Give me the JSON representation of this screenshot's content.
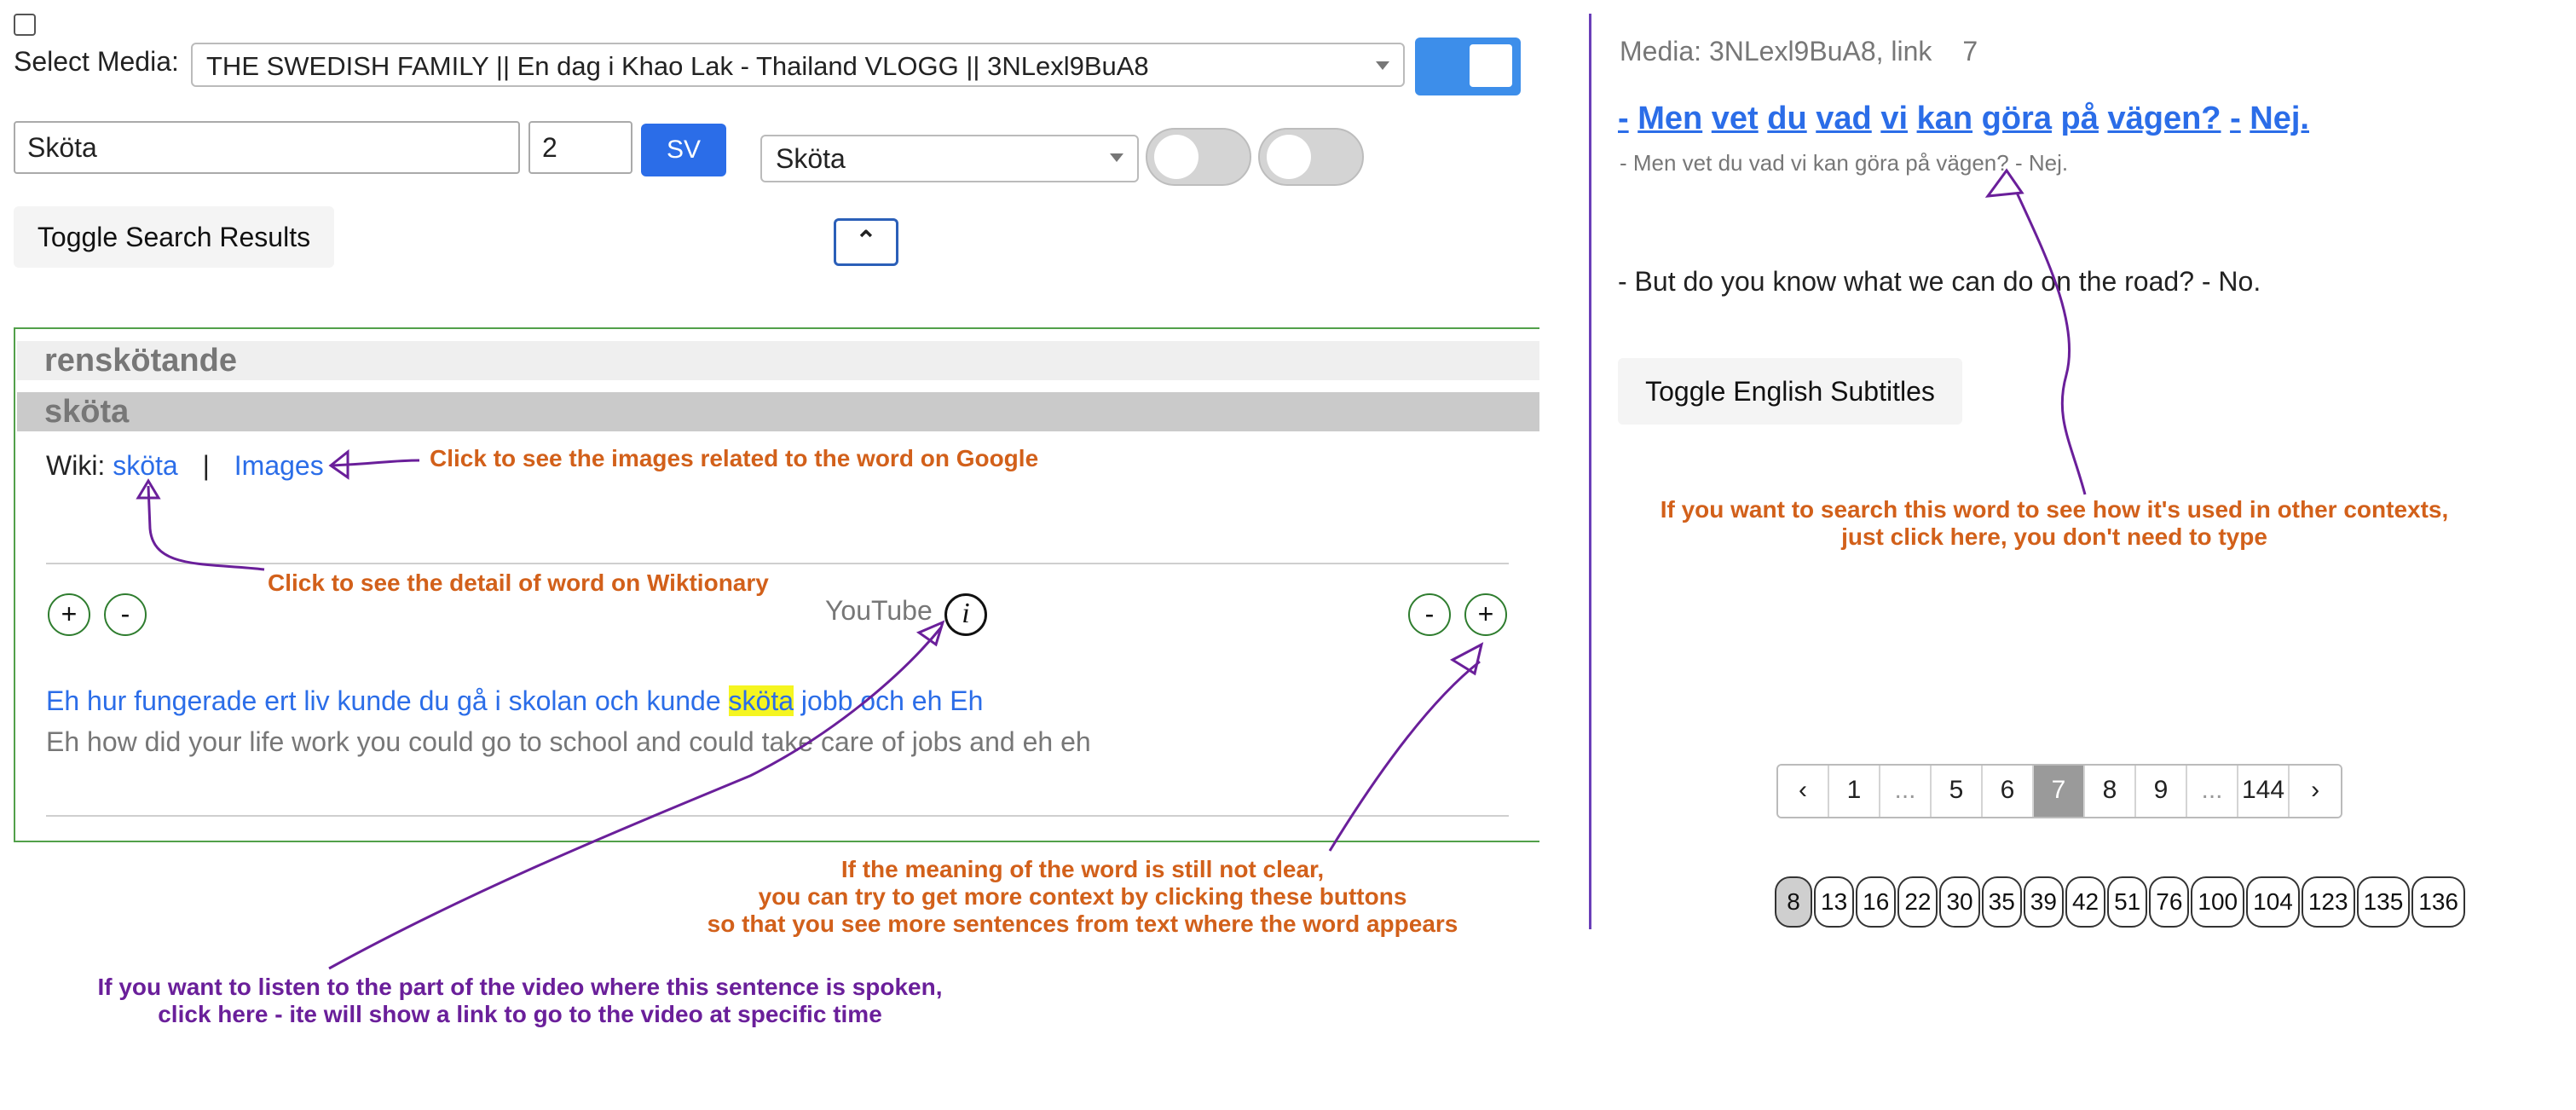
{
  "select_media": {
    "label": "Select Media:",
    "value": "THE SWEDISH FAMILY || En dag i Khao Lak - Thailand VLOGG || 3NLexl9BuA8"
  },
  "search": {
    "query": "Sköta",
    "count": "2",
    "lang_button": "SV",
    "word_dropdown": "Sköta"
  },
  "buttons": {
    "toggle_results": "Toggle Search Results",
    "collapse_glyph": "⌃",
    "toggle_english": "Toggle English Subtitles"
  },
  "results": {
    "word1": "renskötande",
    "word2": "sköta",
    "wiki_label": "Wiki:",
    "wiki_link": "sköta",
    "separator": "|",
    "images_link": "Images",
    "plus": "+",
    "minus": "-",
    "youtube_label": "YouTube",
    "info_glyph": "i",
    "sentence_sv_before": "Eh hur fungerade ert liv kunde du gå i skolan och kunde ",
    "sentence_sv_highlight": "sköta",
    "sentence_sv_after": " jobb och eh Eh",
    "sentence_en": "Eh how did your life work you could go to school and could take care of jobs and eh eh"
  },
  "right_panel": {
    "media_label": "Media: 3NLexl9BuA8, link",
    "media_number": "7",
    "sv_tokens": [
      "-",
      "Men",
      "vet",
      "du",
      "vad",
      "vi",
      "kan",
      "göra",
      "på",
      "vägen?",
      "-",
      "Nej."
    ],
    "sv_subtitle": "- Men vet du vad vi kan göra på vägen? - Nej.",
    "en_subtitle": "- But do you know what we can do on the road? - No."
  },
  "pagination": {
    "items": [
      "‹",
      "1",
      "...",
      "5",
      "6",
      "7",
      "8",
      "9",
      "...",
      "144",
      "›"
    ],
    "active": "7"
  },
  "chips": {
    "items": [
      "8",
      "13",
      "16",
      "22",
      "30",
      "35",
      "39",
      "42",
      "51",
      "76",
      "100",
      "104",
      "123",
      "135",
      "136"
    ],
    "active": "8"
  },
  "annotations": {
    "images": "Click to see the images related to the word on Google",
    "wiktionary": "Click to see the detail of word on Wiktionary",
    "context_line1": "If the meaning of the word is still not clear,",
    "context_line2": "you can try to get more context by clicking these buttons",
    "context_line3": "so that you see more sentences from text where the word appears",
    "youtube_line1": "If you want to listen to the part of the video where this sentence is spoken,",
    "youtube_line2": "click here - ite will show a link to go to the video at specific time",
    "search_line1": "If you want to search this word to see how it's used in other contexts,",
    "search_line2": "just click here, you don't need to type"
  },
  "colors": {
    "accent_blue": "#2b6de8",
    "toggle_on": "#3d8eea",
    "annotation_orange": "#d2601a",
    "annotation_purple": "#6a1f9a",
    "highlight": "#f5f520",
    "results_border": "#52a04a"
  }
}
